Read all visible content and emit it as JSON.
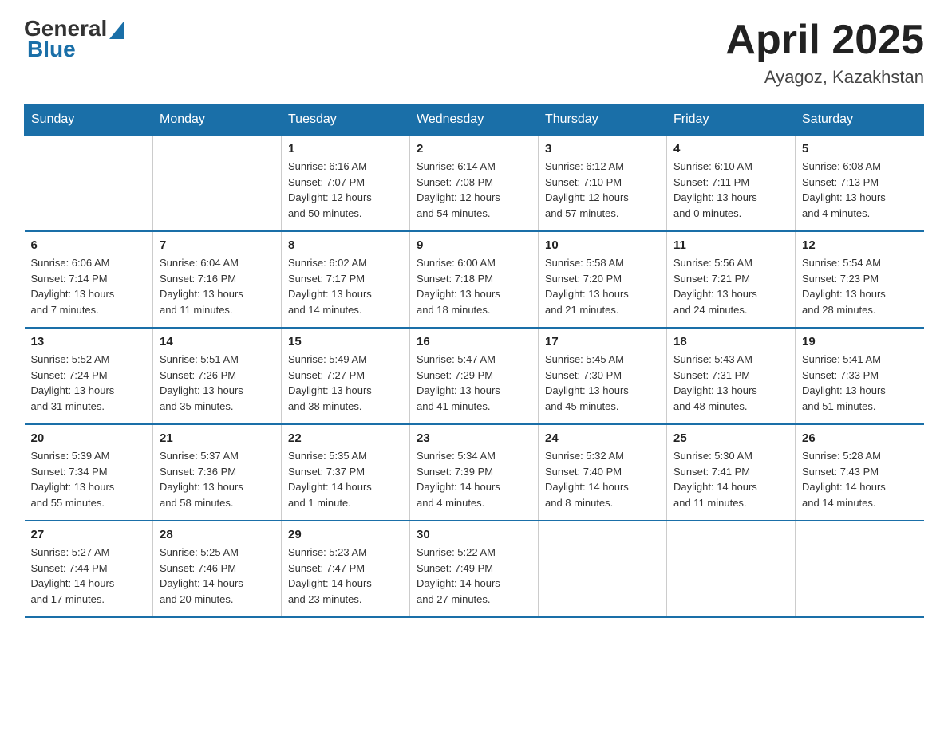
{
  "header": {
    "logo_general": "General",
    "logo_blue": "Blue",
    "title": "April 2025",
    "subtitle": "Ayagoz, Kazakhstan"
  },
  "days_of_week": [
    "Sunday",
    "Monday",
    "Tuesday",
    "Wednesday",
    "Thursday",
    "Friday",
    "Saturday"
  ],
  "weeks": [
    [
      {
        "day": "",
        "info": ""
      },
      {
        "day": "",
        "info": ""
      },
      {
        "day": "1",
        "info": "Sunrise: 6:16 AM\nSunset: 7:07 PM\nDaylight: 12 hours\nand 50 minutes."
      },
      {
        "day": "2",
        "info": "Sunrise: 6:14 AM\nSunset: 7:08 PM\nDaylight: 12 hours\nand 54 minutes."
      },
      {
        "day": "3",
        "info": "Sunrise: 6:12 AM\nSunset: 7:10 PM\nDaylight: 12 hours\nand 57 minutes."
      },
      {
        "day": "4",
        "info": "Sunrise: 6:10 AM\nSunset: 7:11 PM\nDaylight: 13 hours\nand 0 minutes."
      },
      {
        "day": "5",
        "info": "Sunrise: 6:08 AM\nSunset: 7:13 PM\nDaylight: 13 hours\nand 4 minutes."
      }
    ],
    [
      {
        "day": "6",
        "info": "Sunrise: 6:06 AM\nSunset: 7:14 PM\nDaylight: 13 hours\nand 7 minutes."
      },
      {
        "day": "7",
        "info": "Sunrise: 6:04 AM\nSunset: 7:16 PM\nDaylight: 13 hours\nand 11 minutes."
      },
      {
        "day": "8",
        "info": "Sunrise: 6:02 AM\nSunset: 7:17 PM\nDaylight: 13 hours\nand 14 minutes."
      },
      {
        "day": "9",
        "info": "Sunrise: 6:00 AM\nSunset: 7:18 PM\nDaylight: 13 hours\nand 18 minutes."
      },
      {
        "day": "10",
        "info": "Sunrise: 5:58 AM\nSunset: 7:20 PM\nDaylight: 13 hours\nand 21 minutes."
      },
      {
        "day": "11",
        "info": "Sunrise: 5:56 AM\nSunset: 7:21 PM\nDaylight: 13 hours\nand 24 minutes."
      },
      {
        "day": "12",
        "info": "Sunrise: 5:54 AM\nSunset: 7:23 PM\nDaylight: 13 hours\nand 28 minutes."
      }
    ],
    [
      {
        "day": "13",
        "info": "Sunrise: 5:52 AM\nSunset: 7:24 PM\nDaylight: 13 hours\nand 31 minutes."
      },
      {
        "day": "14",
        "info": "Sunrise: 5:51 AM\nSunset: 7:26 PM\nDaylight: 13 hours\nand 35 minutes."
      },
      {
        "day": "15",
        "info": "Sunrise: 5:49 AM\nSunset: 7:27 PM\nDaylight: 13 hours\nand 38 minutes."
      },
      {
        "day": "16",
        "info": "Sunrise: 5:47 AM\nSunset: 7:29 PM\nDaylight: 13 hours\nand 41 minutes."
      },
      {
        "day": "17",
        "info": "Sunrise: 5:45 AM\nSunset: 7:30 PM\nDaylight: 13 hours\nand 45 minutes."
      },
      {
        "day": "18",
        "info": "Sunrise: 5:43 AM\nSunset: 7:31 PM\nDaylight: 13 hours\nand 48 minutes."
      },
      {
        "day": "19",
        "info": "Sunrise: 5:41 AM\nSunset: 7:33 PM\nDaylight: 13 hours\nand 51 minutes."
      }
    ],
    [
      {
        "day": "20",
        "info": "Sunrise: 5:39 AM\nSunset: 7:34 PM\nDaylight: 13 hours\nand 55 minutes."
      },
      {
        "day": "21",
        "info": "Sunrise: 5:37 AM\nSunset: 7:36 PM\nDaylight: 13 hours\nand 58 minutes."
      },
      {
        "day": "22",
        "info": "Sunrise: 5:35 AM\nSunset: 7:37 PM\nDaylight: 14 hours\nand 1 minute."
      },
      {
        "day": "23",
        "info": "Sunrise: 5:34 AM\nSunset: 7:39 PM\nDaylight: 14 hours\nand 4 minutes."
      },
      {
        "day": "24",
        "info": "Sunrise: 5:32 AM\nSunset: 7:40 PM\nDaylight: 14 hours\nand 8 minutes."
      },
      {
        "day": "25",
        "info": "Sunrise: 5:30 AM\nSunset: 7:41 PM\nDaylight: 14 hours\nand 11 minutes."
      },
      {
        "day": "26",
        "info": "Sunrise: 5:28 AM\nSunset: 7:43 PM\nDaylight: 14 hours\nand 14 minutes."
      }
    ],
    [
      {
        "day": "27",
        "info": "Sunrise: 5:27 AM\nSunset: 7:44 PM\nDaylight: 14 hours\nand 17 minutes."
      },
      {
        "day": "28",
        "info": "Sunrise: 5:25 AM\nSunset: 7:46 PM\nDaylight: 14 hours\nand 20 minutes."
      },
      {
        "day": "29",
        "info": "Sunrise: 5:23 AM\nSunset: 7:47 PM\nDaylight: 14 hours\nand 23 minutes."
      },
      {
        "day": "30",
        "info": "Sunrise: 5:22 AM\nSunset: 7:49 PM\nDaylight: 14 hours\nand 27 minutes."
      },
      {
        "day": "",
        "info": ""
      },
      {
        "day": "",
        "info": ""
      },
      {
        "day": "",
        "info": ""
      }
    ]
  ]
}
